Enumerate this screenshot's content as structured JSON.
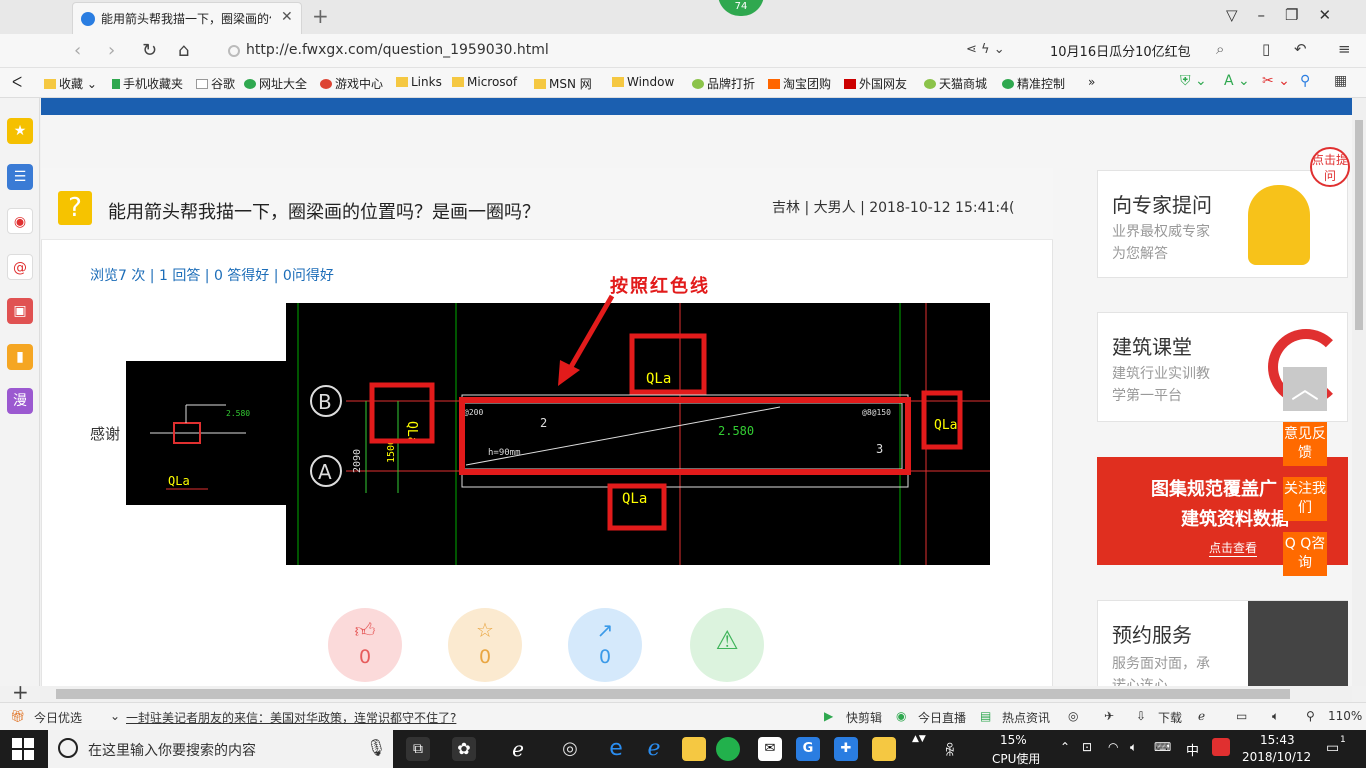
{
  "browser": {
    "tab_title": "能用箭头帮我描一下，圈梁画的位置吗？是画一圈吗？",
    "badge_count": "74",
    "url": "http://e.fwxgx.com/question_1959030.html",
    "search_text": "10月16日瓜分10亿红包",
    "favorites": [
      "收藏",
      "手机收藏夹",
      "谷歌",
      "网址大全",
      "游戏中心",
      "Links",
      "Microsof",
      "MSN 网",
      "Window",
      "品牌打折",
      "淘宝团购",
      "外国网友",
      "天猫商城",
      "精准控制"
    ]
  },
  "question": {
    "title": "能用箭头帮我描一下，圈梁画的位置吗？是画一圈吗？",
    "meta": "吉林 | 大男人 | 2018-10-12 15:41:4(",
    "stats": "浏览7 次 | 1 回答 | 0 答得好 | 0问得好",
    "body_text": "感谢",
    "annotation_label": "按照红色线"
  },
  "cad": {
    "labels": [
      "QLa",
      "QLa",
      "QLa",
      "QLa",
      "QLa"
    ],
    "axis_b": "B",
    "axis_a": "A",
    "dim_2090": "2090",
    "dim_1500": "1500",
    "elev": "2.580",
    "beam_h": "h=90mm",
    "rebar_200": "@200",
    "rebar_150": "@8@150",
    "num_2": "2",
    "num_3": "3"
  },
  "actions": [
    {
      "icon": "thumbs-up",
      "count": "0",
      "color": "#fbdada",
      "fg": "#e65c5c"
    },
    {
      "icon": "star",
      "count": "0",
      "color": "#fbead0",
      "fg": "#e9a642"
    },
    {
      "icon": "share",
      "count": "0",
      "color": "#d5e9fb",
      "fg": "#3b9ae8"
    },
    {
      "icon": "warning",
      "count": "",
      "color": "#dcf3de",
      "fg": "#3fb45a"
    }
  ],
  "sidebar_right": {
    "expert_title": "向专家提问",
    "expert_sub1": "业界最权威专家",
    "expert_sub2": "为您解答",
    "click_hint": "点击提问",
    "class_title": "建筑课堂",
    "class_sub1": "建筑行业实训教",
    "class_sub2": "学第一平台",
    "banner1": "图集规范覆盖广",
    "banner2": "建筑资料数据",
    "banner_btn": "点击查看",
    "service_title": "预约服务",
    "service_sub1": "服务面对面，承",
    "service_sub2": "诺心连心",
    "float_feedback": "意见反馈",
    "float_follow": "关注我们",
    "float_qq": "Q Q咨询"
  },
  "statusbar": {
    "today_pick": "今日优选",
    "news": "一封驻美记者朋友的来信：美国对华政策，连常识都守不住了?",
    "kuaijianji": "快剪辑",
    "live": "今日直播",
    "hot": "热点资讯",
    "download": "下载",
    "zoom": "110%"
  },
  "taskbar": {
    "search_placeholder": "在这里输入你要搜索的内容",
    "cpu_percent": "15%",
    "cpu_label": "CPU使用",
    "lang": "中",
    "time": "15:43",
    "date": "2018/10/12",
    "notif_count": "1"
  }
}
